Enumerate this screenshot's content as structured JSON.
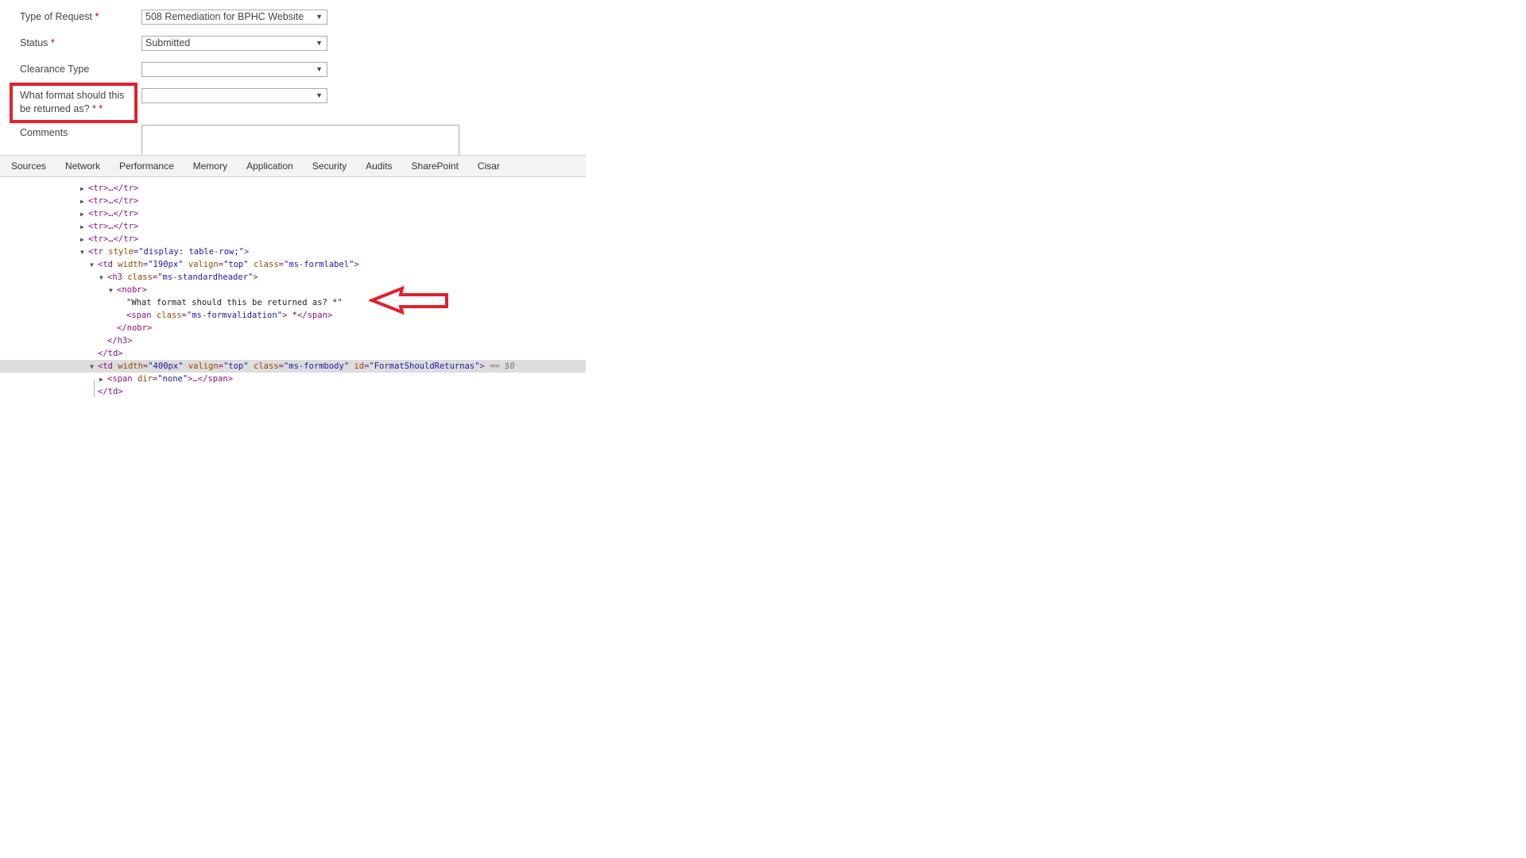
{
  "form": {
    "fields": [
      {
        "label": "Type of Request",
        "required_mark": "*",
        "value": "508 Remediation for BPHC Website"
      },
      {
        "label": "Status",
        "required_mark": "*",
        "value": "Submitted"
      },
      {
        "label": "Clearance Type",
        "required_mark": "",
        "value": ""
      },
      {
        "label_line1": "What format should this",
        "label_line2": "be returned as? *",
        "required_mark": "*",
        "value": ""
      },
      {
        "label": "Comments",
        "value": ""
      }
    ],
    "dropdown_arrow": "▼",
    "highlight_color": "#e3202a"
  },
  "devtools": {
    "tabs": [
      "Sources",
      "Network",
      "Performance",
      "Memory",
      "Application",
      "Security",
      "Audits",
      "SharePoint",
      "Cisar"
    ],
    "tree": {
      "collapsed_row": "<tr>…</tr>",
      "tr_open": "<tr",
      "tr_attr_name": "style",
      "tr_attr_value": "\"display: table-row;\"",
      "td_label_attrs": [
        {
          "name": "width",
          "value": "\"190px\""
        },
        {
          "name": "valign",
          "value": "\"top\""
        },
        {
          "name": "class",
          "value": "\"ms-formlabel\""
        }
      ],
      "h3_class": "\"ms-standardheader\"",
      "nobr_open": "<nobr>",
      "text_node": "\"What format should this be returned as? *\"",
      "span_class": "\"ms-formvalidation\"",
      "span_text": " *",
      "nobr_close": "</nobr>",
      "h3_close": "</h3>",
      "td_close": "</td>",
      "td_body_attrs": [
        {
          "name": "width",
          "value": "\"400px\""
        },
        {
          "name": "valign",
          "value": "\"top\""
        },
        {
          "name": "class",
          "value": "\"ms-formbody\""
        },
        {
          "name": "id",
          "value": "\"FormatShouldReturnas\""
        }
      ],
      "selected_marker": "== $0",
      "span_dir_attr": "\"none\""
    }
  }
}
